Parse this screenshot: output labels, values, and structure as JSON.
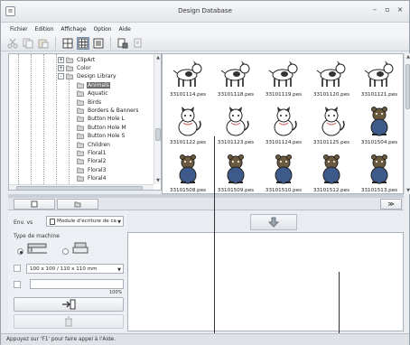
{
  "window": {
    "title": "Design Database",
    "system_icon": "app-menu-icon",
    "controls": [
      "minimize-icon",
      "maximize-icon",
      "close-icon"
    ]
  },
  "menu": [
    "Fichier",
    "Edition",
    "Affichage",
    "Option",
    "Aide"
  ],
  "toolbar": {
    "buttons": [
      "cut-icon",
      "copy-icon",
      "paste-icon",
      "large-thumbnails-icon",
      "medium-thumbnails-icon",
      "details-view-icon",
      "send-to-machine-icon",
      "properties-icon"
    ]
  },
  "tree": {
    "items": [
      {
        "label": "ClipArt",
        "depth": 0,
        "expander": "+"
      },
      {
        "label": "Color",
        "depth": 0,
        "expander": "+"
      },
      {
        "label": "Design Library",
        "depth": 0,
        "expander": "-"
      },
      {
        "label": "Animals",
        "depth": 1,
        "selected": true
      },
      {
        "label": "Aquatic",
        "depth": 1
      },
      {
        "label": "Birds",
        "depth": 1
      },
      {
        "label": "Borders & Banners",
        "depth": 1
      },
      {
        "label": "Button Hole L",
        "depth": 1
      },
      {
        "label": "Button Hole M",
        "depth": 1
      },
      {
        "label": "Button Hole S",
        "depth": 1
      },
      {
        "label": "Children",
        "depth": 1
      },
      {
        "label": "Floral1",
        "depth": 1
      },
      {
        "label": "Floral2",
        "depth": 1
      },
      {
        "label": "Floral3",
        "depth": 1
      },
      {
        "label": "Floral4",
        "depth": 1
      }
    ]
  },
  "thumbnails": [
    {
      "file": "33101114.pes",
      "icon": "dog-icon"
    },
    {
      "file": "33101118.pes",
      "icon": "dog-icon"
    },
    {
      "file": "33101119.pes",
      "icon": "dog-icon"
    },
    {
      "file": "33101120.pes",
      "icon": "dog-icon"
    },
    {
      "file": "33101121.pes",
      "icon": "dog-icon"
    },
    {
      "file": "33101122.pes",
      "icon": "cat-icon"
    },
    {
      "file": "33101123.pes",
      "icon": "cat-icon"
    },
    {
      "file": "33101124.pes",
      "icon": "cat-icon"
    },
    {
      "file": "33101125.pes",
      "icon": "cat-icon"
    },
    {
      "file": "33101504.pes",
      "icon": "bear-icon"
    },
    {
      "file": "33101508.pes",
      "icon": "bear-icon"
    },
    {
      "file": "33101509.pes",
      "icon": "bear-icon"
    },
    {
      "file": "33101510.pes",
      "icon": "bear-icon"
    },
    {
      "file": "33101512.pes",
      "icon": "bear-icon"
    },
    {
      "file": "33101513.pes",
      "icon": "bear-icon"
    }
  ],
  "lower": {
    "env_label": "Env. vs",
    "env_value": "Module d'écriture de carte",
    "machine_label": "Type de machine",
    "hoop_value": "100 x 100 / 110 x 110 mm",
    "progress_text": "100%",
    "progress": 1.0
  },
  "status": {
    "text": "Appuyez sur 'F1' pour faire appel à l'Aide."
  }
}
